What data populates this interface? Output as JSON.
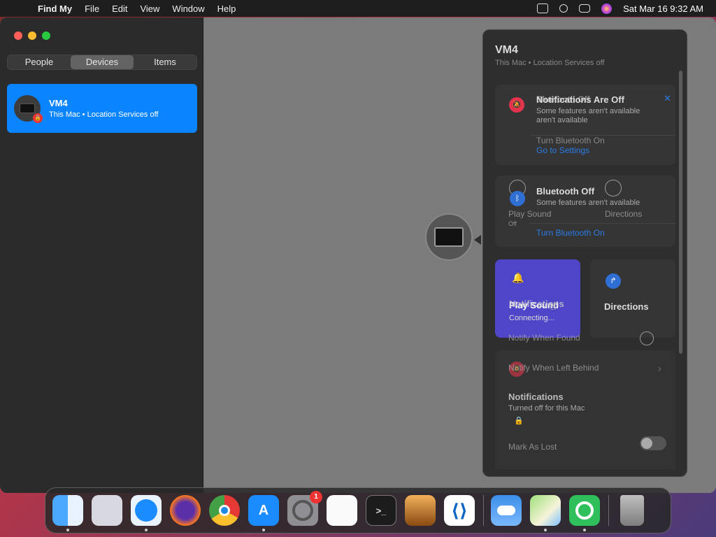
{
  "menubar": {
    "app_name": "Find My",
    "menus": [
      "File",
      "Edit",
      "View",
      "Window",
      "Help"
    ],
    "datetime": "Sat Mar 16  9:32 AM"
  },
  "sidebar": {
    "tabs": [
      "People",
      "Devices",
      "Items"
    ],
    "active_tab": "Devices",
    "device": {
      "name": "VM4",
      "subtitle": "This Mac • Location Services off"
    }
  },
  "panel": {
    "title": "VM4",
    "subtitle": "This Mac • Location Services off",
    "notifications_card": {
      "title_overlap": "Notifications Are Off",
      "title_ghost": "Bluetooth Off",
      "text": "Some features aren't available",
      "ghost_text": "aren't available",
      "action_ghost": "Turn Bluetooth On",
      "link": "Go to Settings",
      "close": "✕"
    },
    "bluetooth_card": {
      "title": "Bluetooth Off",
      "text": "Some features aren't available",
      "ghost_left": "Play Sound",
      "ghost_right": "Directions",
      "ghost_small": "Off",
      "link": "Turn Bluetooth On"
    },
    "play_tile": {
      "label": "Play Sound",
      "overlap_label": "Notifications",
      "status": "Connecting..."
    },
    "directions_tile": {
      "label": "Directions"
    },
    "notify_found": "Notify When Found",
    "notify_left": "Notify When Left Behind",
    "notif_section": {
      "title": "Notifications",
      "text": "Turned off for this Mac"
    },
    "mark_lost": "Mark As Lost",
    "ghost_faint": "Notify When Found"
  },
  "dock": {
    "apps": [
      "Finder",
      "Launchpad",
      "Safari",
      "Firefox",
      "Chrome",
      "App Store",
      "System Settings",
      "TextEdit",
      "Terminal",
      "GarageBand",
      "Visual Studio Code",
      "Weather",
      "Maps",
      "Find My",
      "Trash"
    ],
    "settings_badge": "1"
  },
  "colors": {
    "accent": "#0a84ff",
    "link": "#2a7be4",
    "play_tile": "#4f45c8",
    "alert_red": "#e2354d"
  }
}
